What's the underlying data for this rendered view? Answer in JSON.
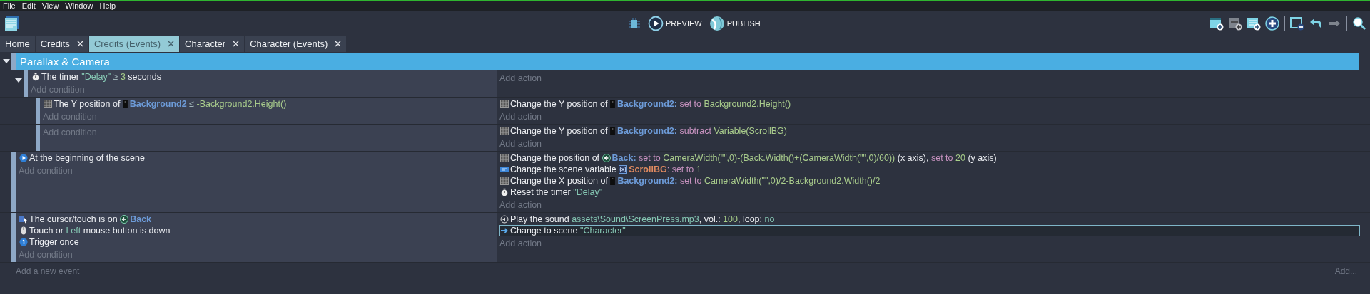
{
  "menu": [
    {
      "label": "File"
    },
    {
      "label": "Edit"
    },
    {
      "label": "View"
    },
    {
      "label": "Window"
    },
    {
      "label": "Help"
    }
  ],
  "toolbar": {
    "center": [
      {
        "kind": "debug"
      },
      {
        "kind": "preview",
        "label": "PREVIEW"
      },
      {
        "kind": "publish",
        "label": "PUBLISH"
      }
    ],
    "right": [
      {
        "kind": "add-event",
        "disabled": false
      },
      {
        "kind": "add-subevent",
        "disabled": true
      },
      {
        "kind": "add-comment",
        "disabled": false
      },
      {
        "kind": "add-other",
        "disabled": false
      },
      {
        "kind": "separator"
      },
      {
        "kind": "delete",
        "disabled": false
      },
      {
        "kind": "undo",
        "disabled": false
      },
      {
        "kind": "redo",
        "disabled": true
      },
      {
        "kind": "separator"
      },
      {
        "kind": "search",
        "disabled": false
      }
    ]
  },
  "tabs": [
    {
      "label": "Home",
      "closable": false,
      "selected": false
    },
    {
      "label": "Credits",
      "closable": true,
      "selected": false
    },
    {
      "label": "Credits (Events)",
      "closable": true,
      "selected": true
    },
    {
      "label": "Character",
      "closable": true,
      "selected": false
    },
    {
      "label": "Character (Events)",
      "closable": true,
      "selected": false
    }
  ],
  "events": [
    {
      "kind": "group",
      "title": "Parallax & Camera",
      "expanded": true,
      "children": [
        {
          "kind": "standard",
          "expanded": true,
          "conditions": [
            {
              "kind": "timer",
              "selected": false,
              "parts": [
                {
                  "kind": "plain",
                  "text": "The timer "
                },
                {
                  "kind": "string",
                  "text": "\"Delay\""
                },
                {
                  "kind": "operator",
                  "text": " ≥ "
                },
                {
                  "kind": "number",
                  "text": "3"
                },
                {
                  "kind": "plain",
                  "text": " seconds"
                }
              ]
            }
          ],
          "add_condition": "Add condition",
          "add_action": "Add action",
          "children": [
            {
              "kind": "standard",
              "conditions": [
                {
                  "kind": "position",
                  "selected": false,
                  "parts": [
                    {
                      "kind": "plain",
                      "text": "The Y position of "
                    },
                    {
                      "kind": "sprite-object",
                      "text": "Background2"
                    },
                    {
                      "kind": "operator",
                      "text": " ≤ "
                    },
                    {
                      "kind": "expression",
                      "text": "-Background2.Height()"
                    }
                  ]
                }
              ],
              "add_condition": "Add condition",
              "actions": [
                {
                  "kind": "position",
                  "selected": false,
                  "parts": [
                    {
                      "kind": "plain",
                      "text": "Change the Y position of "
                    },
                    {
                      "kind": "sprite-object",
                      "text": "Background2:"
                    },
                    {
                      "kind": "keyword",
                      "text": " set to "
                    },
                    {
                      "kind": "expression",
                      "text": "Background2.Height()"
                    }
                  ]
                }
              ],
              "add_action": "Add action"
            },
            {
              "kind": "standard",
              "add_condition": "Add condition",
              "actions": [
                {
                  "kind": "position",
                  "selected": false,
                  "parts": [
                    {
                      "kind": "plain",
                      "text": "Change the Y position of "
                    },
                    {
                      "kind": "sprite-object",
                      "text": "Background2:"
                    },
                    {
                      "kind": "keyword",
                      "text": " subtract "
                    },
                    {
                      "kind": "expression",
                      "text": "Variable(ScrollBG)"
                    }
                  ]
                }
              ],
              "add_action": "Add action"
            }
          ]
        }
      ]
    },
    {
      "kind": "standard",
      "conditions": [
        {
          "kind": "scene-start",
          "selected": false,
          "parts": [
            {
              "kind": "plain",
              "text": "At the beginning of the scene"
            }
          ]
        }
      ],
      "add_condition": "Add condition",
      "actions": [
        {
          "kind": "position",
          "selected": false,
          "parts": [
            {
              "kind": "plain",
              "text": "Change the position of "
            },
            {
              "kind": "button-object",
              "text": "Back:"
            },
            {
              "kind": "keyword",
              "text": " set to "
            },
            {
              "kind": "expression",
              "text": "CameraWidth(\"\",0)-(Back.Width()+(CameraWidth(\"\",0)/60))"
            },
            {
              "kind": "plain",
              "text": " (x axis), "
            },
            {
              "kind": "keyword",
              "text": "set to "
            },
            {
              "kind": "number",
              "text": "20"
            },
            {
              "kind": "plain",
              "text": " (y axis)"
            }
          ]
        },
        {
          "kind": "scene-variable",
          "selected": false,
          "parts": [
            {
              "kind": "plain",
              "text": "Change the scene variable "
            },
            {
              "kind": "variable",
              "text": "ScrollBG"
            },
            {
              "kind": "keyword",
              "text": ": set to "
            },
            {
              "kind": "number",
              "text": "1"
            }
          ]
        },
        {
          "kind": "position",
          "selected": false,
          "parts": [
            {
              "kind": "plain",
              "text": "Change the X position of "
            },
            {
              "kind": "sprite-object",
              "text": "Background2:"
            },
            {
              "kind": "keyword",
              "text": " set to "
            },
            {
              "kind": "expression",
              "text": "CameraWidth(\"\",0)/2-Background2.Width()/2"
            }
          ]
        },
        {
          "kind": "timer",
          "selected": false,
          "parts": [
            {
              "kind": "plain",
              "text": "Reset the timer "
            },
            {
              "kind": "string",
              "text": "\"Delay\""
            }
          ]
        }
      ],
      "add_action": "Add action"
    },
    {
      "kind": "standard",
      "conditions": [
        {
          "kind": "cursor",
          "selected": false,
          "parts": [
            {
              "kind": "plain",
              "text": "The cursor/touch is on "
            },
            {
              "kind": "button-object",
              "text": "Back"
            }
          ]
        },
        {
          "kind": "mouse",
          "selected": false,
          "parts": [
            {
              "kind": "plain",
              "text": "Touch or "
            },
            {
              "kind": "string",
              "text": "Left"
            },
            {
              "kind": "plain",
              "text": " mouse button is down"
            }
          ]
        },
        {
          "kind": "trigger-once",
          "selected": false,
          "parts": [
            {
              "kind": "plain",
              "text": "Trigger once"
            }
          ]
        }
      ],
      "add_condition": "Add condition",
      "actions": [
        {
          "kind": "sound",
          "selected": false,
          "parts": [
            {
              "kind": "plain",
              "text": "Play the sound "
            },
            {
              "kind": "string",
              "text": "assets\\Sound\\ScreenPress.mp3"
            },
            {
              "kind": "plain",
              "text": ", vol.: "
            },
            {
              "kind": "number",
              "text": "100"
            },
            {
              "kind": "plain",
              "text": ", loop: "
            },
            {
              "kind": "string",
              "text": "no"
            }
          ]
        },
        {
          "kind": "scene-change",
          "selected": true,
          "parts": [
            {
              "kind": "plain",
              "text": "Change to scene "
            },
            {
              "kind": "string",
              "text": "\"Character\""
            }
          ]
        }
      ],
      "add_action": "Add action"
    }
  ],
  "footer": {
    "add_event": "Add a new event",
    "add_other": "Add..."
  }
}
